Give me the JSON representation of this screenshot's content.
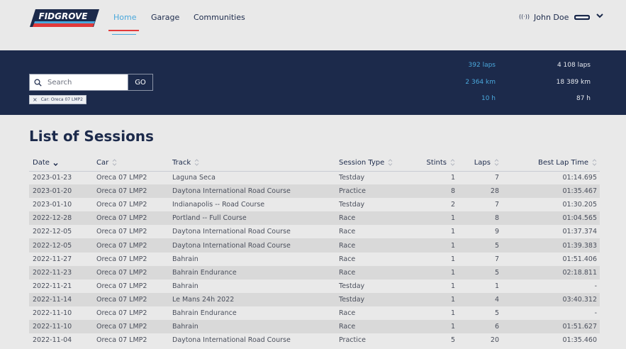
{
  "brand": {
    "logo_text": "FIDGROVE"
  },
  "nav": {
    "items": [
      {
        "label": "Home",
        "active": true
      },
      {
        "label": "Garage",
        "active": false
      },
      {
        "label": "Communities",
        "active": false
      }
    ]
  },
  "user": {
    "name": "John Doe",
    "live_icon": "((·))"
  },
  "search": {
    "placeholder": "Search",
    "value": "",
    "button_label": "GO"
  },
  "filter_chip": {
    "label": "Car: Oreca 07 LMP2",
    "close": "×"
  },
  "stats": {
    "filtered": [
      "392 laps",
      "2 364 km",
      "10 h"
    ],
    "total": [
      "4 108 laps",
      "18 389 km",
      "87 h"
    ]
  },
  "page": {
    "title": "List of Sessions"
  },
  "table": {
    "columns": [
      "Date",
      "Car",
      "Track",
      "Session Type",
      "Stints",
      "Laps",
      "Best Lap Time"
    ],
    "rows": [
      [
        "2023-01-23",
        "Oreca 07 LMP2",
        "Laguna Seca",
        "Testday",
        "1",
        "7",
        "01:14.695"
      ],
      [
        "2023-01-20",
        "Oreca 07 LMP2",
        "Daytona International Road Course",
        "Practice",
        "8",
        "28",
        "01:35.467"
      ],
      [
        "2023-01-10",
        "Oreca 07 LMP2",
        "Indianapolis -- Road Course",
        "Testday",
        "2",
        "7",
        "01:30.205"
      ],
      [
        "2022-12-28",
        "Oreca 07 LMP2",
        "Portland -- Full Course",
        "Race",
        "1",
        "8",
        "01:04.565"
      ],
      [
        "2022-12-05",
        "Oreca 07 LMP2",
        "Daytona International Road Course",
        "Race",
        "1",
        "9",
        "01:37.374"
      ],
      [
        "2022-12-05",
        "Oreca 07 LMP2",
        "Daytona International Road Course",
        "Race",
        "1",
        "5",
        "01:39.383"
      ],
      [
        "2022-11-27",
        "Oreca 07 LMP2",
        "Bahrain",
        "Race",
        "1",
        "7",
        "01:51.406"
      ],
      [
        "2022-11-23",
        "Oreca 07 LMP2",
        "Bahrain Endurance",
        "Race",
        "1",
        "5",
        "02:18.811"
      ],
      [
        "2022-11-21",
        "Oreca 07 LMP2",
        "Bahrain",
        "Testday",
        "1",
        "1",
        "-"
      ],
      [
        "2022-11-14",
        "Oreca 07 LMP2",
        "Le Mans 24h 2022",
        "Testday",
        "1",
        "4",
        "03:40.312"
      ],
      [
        "2022-11-10",
        "Oreca 07 LMP2",
        "Bahrain Endurance",
        "Race",
        "1",
        "5",
        "-"
      ],
      [
        "2022-11-10",
        "Oreca 07 LMP2",
        "Bahrain",
        "Race",
        "1",
        "6",
        "01:51.627"
      ],
      [
        "2022-11-04",
        "Oreca 07 LMP2",
        "Daytona International Road Course",
        "Practice",
        "5",
        "20",
        "01:35.460"
      ]
    ]
  },
  "colors": {
    "navy": "#1c2a4b",
    "accent_blue": "#4aa8dc",
    "accent_red": "#e23a3a",
    "page_bg": "#e9e9e9",
    "stripe": "#d9d9d9"
  },
  "icons": {
    "search": "search-icon",
    "sort": "sort-icon",
    "user_menu": "chevron-down-icon",
    "live": "broadcast-icon",
    "badge": "user-badge-icon"
  }
}
